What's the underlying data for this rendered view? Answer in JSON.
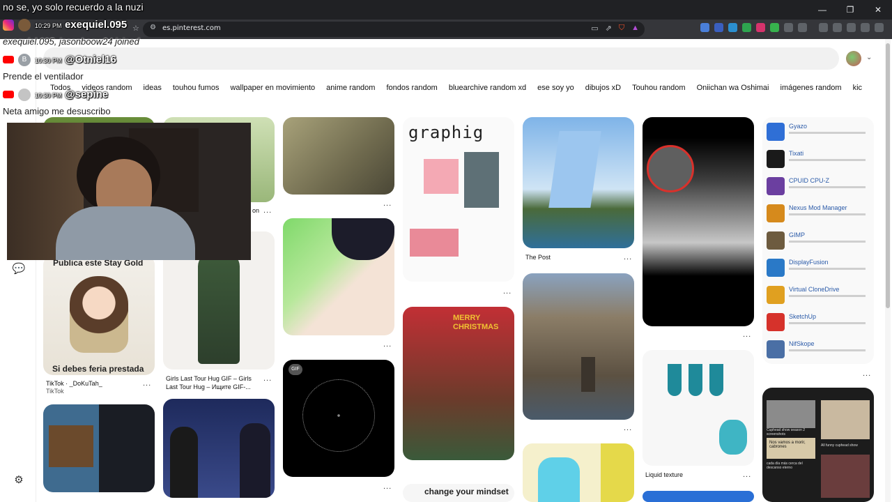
{
  "overlay_top_text": "no se, yo solo recuerdo a la nuzi",
  "window_controls": {
    "minimize": "—",
    "restore": "❐",
    "close": "✕"
  },
  "address": {
    "url": "es.pinterest.com"
  },
  "chat": [
    {
      "platform": "instagram",
      "time": "10:29 PM",
      "user": "exequiel.095",
      "message": "exequiel.095, jasonboow24 joined"
    },
    {
      "platform": "youtube",
      "avatar": "B",
      "time": "10:30 PM",
      "user": "@Otniel16",
      "message": "Prende el ventilador"
    },
    {
      "platform": "youtube",
      "time": "10:30 PM",
      "user": "@sepine",
      "message": "Neta amigo me desuscribo"
    }
  ],
  "chips": [
    "Todos",
    "videos random",
    "ideas",
    "touhou fumos",
    "wallpaper en movimiento",
    "anime random",
    "fondos random",
    "bluearchive random xd",
    "ese soy yo",
    "dibujos xD",
    "Touhou random",
    "Oniichan wa Oshimai",
    "imágenes random",
    "kic"
  ],
  "pins": {
    "stay_gold": {
      "top": "Publica este Stay Gold",
      "bottom": "Si debes feria prestada",
      "title": "TikTok · _DoKuTah_",
      "source": "TikTok"
    },
    "col2_top": {
      "title_tail": "on"
    },
    "girls_last_tour": {
      "title": "Girls Last Tour Hug GIF – Girls Last Tour Hug – Ищите GIF-..."
    },
    "gif_badge": "GIF",
    "graphig": {
      "logo": "graphig"
    },
    "christmas": {
      "text": "MERRY CHRISTMAS"
    },
    "mindset": {
      "text": "change your mindset"
    },
    "the_post": {
      "title": "The Post"
    },
    "liquid_texture": {
      "title": "Liquid texture"
    },
    "software_list": [
      {
        "name": "Gyazo",
        "color": "#2f6fd6"
      },
      {
        "name": "Tixati",
        "color": "#1a1a1a"
      },
      {
        "name": "CPUID CPU-Z",
        "color": "#6b3fa0"
      },
      {
        "name": "Nexus Mod Manager",
        "color": "#d68a1c"
      },
      {
        "name": "GIMP",
        "color": "#6d5b3f"
      },
      {
        "name": "DisplayFusion",
        "color": "#2a79c7"
      },
      {
        "name": "Virtual CloneDrive",
        "color": "#e0a020"
      },
      {
        "name": "SketchUp",
        "color": "#d6322b"
      },
      {
        "name": "NifSkope",
        "color": "#4a6fa5"
      }
    ],
    "cuphead": {
      "labels": [
        "Cuphead show season 2 screenshots",
        "Nos vamos a morir, cabrones",
        "All funny cuphead show",
        "cada día más cerca del descanso eterno"
      ]
    }
  },
  "more_dots": "..."
}
